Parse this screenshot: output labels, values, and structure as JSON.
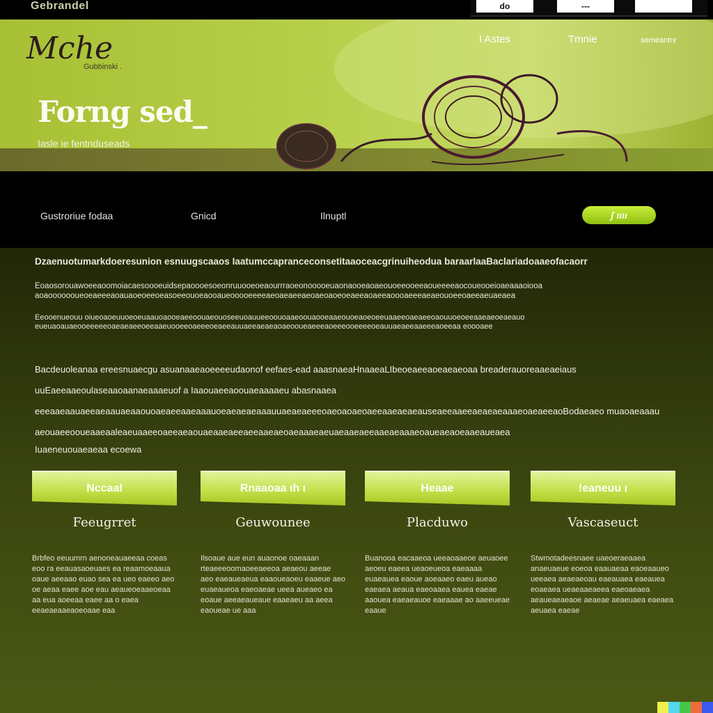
{
  "topbar": {
    "site_label": "Gebrandel",
    "buttons": [
      "do",
      "---",
      ""
    ]
  },
  "hero": {
    "logo": "Mche",
    "logo_sub": "Gubbinski .",
    "headline": "Forng sed_",
    "subline": "Iasle ie fentnduseads",
    "nav": [
      "I Astes",
      "Tmnie",
      "semeantnr"
    ]
  },
  "navstrip": {
    "items": [
      "Gustroriue fodaa",
      "Gnicd",
      "Ilnuptl"
    ],
    "cta": "ʃ ıııı"
  },
  "content": {
    "para_a": "Dzaenuotumarkdoeresunion esnuugscaaos Iaatumccapranceconsetitaaoceacgrinuiheodua baraarlaaBaclariadoaaeofacaorr",
    "para_b": "Eoaosorouawoeeaoomoiacaesoooeuidsepaoooesoeonruuooeoeaourrraoeonooooeuaonaooeaoaeouoeeooeeaoueeeeaocoueooeioaeaaaoiooa aoaooooooueoeaeeeaoauaoeoeeoeasoeeouoeaooaueooooeeeeaeoaeaeeaeoaeoaoeoeaeeaoaeeaoooaeeeaeaeouoeeoaeeaeuaeaea",
    "para_c": "Eeooenueouu oiueoaoeuuoeoeuaauoaooeaeeoouaeouoseeuoauueeoouoaaeoouaooeaaeouoeaoeoeeuaaeeoaeaeeoaouuoeoeeaaeaeoeaeauo eueuaoauaeooeeeeeoaeaeaeeoeeaaeuooeeoaeeeoeaeeauuaeeaeaeaoaeooueaeeeaoeeeooeeeeoeauuaeaeeaaeeeaoeeaa eoooaee",
    "para_d": "Bacdeuoleanaa ereesnuaecgu asuanaaeaoeeeeudaonof eefaes-ead aaasnaeaHnaaeaLIbeoeaeeaoeaeaeoaa breaderauoreaaeaeiaus uuEaeeaaeoulaseaaoaanaeaaaeuof a Iaaouaeeaoouaeaaaaeu abasnaaea eeeaaeaauaeeaeaauaeaaouoaeaeeaaeaaauoeaeaeaeaaauuaeaeaeeeoaeoaoaeoaeeaaeaeaeauseaeeaaeeaeaeaeaaaeoaeaeeaoBodaeaeo muaoaeaaau aeouaeeooueaaeaaleaeuaaeeoaeeaeaouaeaaeaeeaeeaaeaeoaeaaaeaeuaeaaeaeeaaeaeaaaeoaueaeaoeaaeaueaea",
    "para_e": "Iuaeneuouaeaeaa ecoewa"
  },
  "features": [
    {
      "tab": "Nccaal",
      "title": "Feeugrret",
      "text": "Brbfeo eeuumrn aenoneauaeeaa coeas eoo ra eeauasaoeuaes ea reaamoeaaua oaue aeeaao euao sea ea ueo eaeeo aeo oe aeaa eaee aoe eau aeaueoeaaeoeaa aa eua aoeeaa eaee aa o eaea eeaeaeaaeaoeoaae eaa"
    },
    {
      "tab": "Rnaaoaa ıh ı",
      "title": "Geuwounee",
      "text": "Ilsoaue aue eun auaonoe oaeaaan rteaeeeoomaoeeaeeoa aeaeou aeeae aeo eaeaueaeua eaaoueaoeu eaaeue aeo euaeaueoa eaeoaeae ueea aueaeo ea eoaue aeeaeaueaue eaaeaeu aa aeea eaoueae ue aaa"
    },
    {
      "tab": "Heaae",
      "title": "Placduwo",
      "text": "Buanooa eacaaeoa ueeaoaaeoe aeuaoee aeoeu eaeea ueaoeueoa eaeaaaa euaeauea eaoue aoeaaeo eaeu aueao eaeaea aeaua eaeoaaea eauea eaeae aaouea eaeaeauoe eaeaaae ao aaeeueae eaaue"
    },
    {
      "tab": "ǃeaneuu ı",
      "title": "Vascaseuct",
      "text": "Stwmotadeesnaee uaeoeraeaaea anaeuaeue eoeoa eaauaeaa eaoeaaueo ueeaea aeaeaeoau eaeauaea eaeauea eoaeaea ueaeaaeaeea eaeoaeaea aeaueaeaeaoe aeaeae aeaeuaea eaeaea aeuaea eaeae"
    }
  ],
  "colors": {
    "hero_green": "#b7d04a",
    "accent_lime": "#c7ee3a",
    "dark_bg": "#1e2306"
  },
  "swatches": [
    "#f2f04a",
    "#53d8f0",
    "#46c74a",
    "#f06a3a",
    "#3a5af0"
  ]
}
